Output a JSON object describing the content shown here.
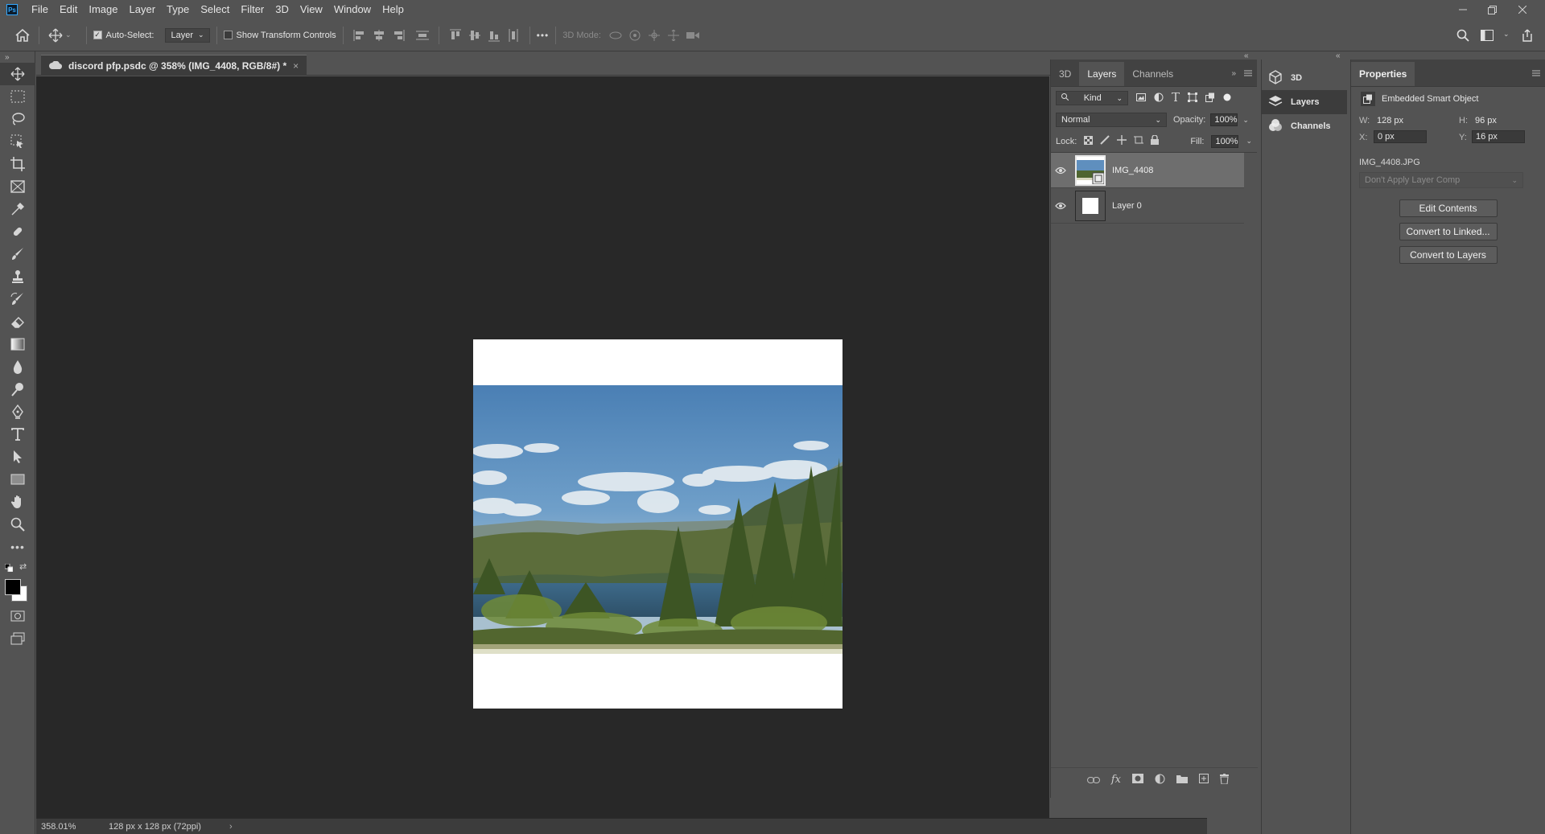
{
  "menubar": {
    "app_icon": "Ps",
    "items": [
      "File",
      "Edit",
      "Image",
      "Layer",
      "Type",
      "Select",
      "Filter",
      "3D",
      "View",
      "Window",
      "Help"
    ],
    "window_controls": [
      "minimize-icon",
      "restore-icon",
      "close-icon"
    ]
  },
  "options": {
    "auto_select_label": "Auto-Select:",
    "auto_select_checked": true,
    "auto_select_value": "Layer",
    "transform_label": "Show Transform Controls",
    "transform_checked": false,
    "more_label": "•••",
    "mode_label": "3D Mode:"
  },
  "document": {
    "tab_title": "discord pfp.psdc @ 358% (IMG_4408, RGB/8#) *",
    "close": "×"
  },
  "status": {
    "zoom": "358.01%",
    "doc_info": "128 px x 128 px (72ppi)",
    "arrow": "›"
  },
  "layers_panel": {
    "tabs": [
      "3D",
      "Layers",
      "Channels"
    ],
    "active_tab": "Layers",
    "filter_kind": "Kind",
    "blend_mode": "Normal",
    "opacity_label": "Opacity:",
    "opacity_value": "100%",
    "lock_label": "Lock:",
    "fill_label": "Fill:",
    "fill_value": "100%",
    "layers": [
      {
        "name": "IMG_4408",
        "visible": true,
        "selected": true,
        "type": "smart-object"
      },
      {
        "name": "Layer 0",
        "visible": true,
        "selected": false,
        "type": "normal"
      }
    ]
  },
  "mini_panel": {
    "items": [
      {
        "label": "3D",
        "icon": "cube-icon"
      },
      {
        "label": "Layers",
        "icon": "layers-icon"
      },
      {
        "label": "Channels",
        "icon": "channels-icon"
      }
    ],
    "active": "Layers"
  },
  "properties": {
    "title": "Properties",
    "object_type": "Embedded Smart Object",
    "w_label": "W:",
    "w_value": "128 px",
    "h_label": "H:",
    "h_value": "96 px",
    "x_label": "X:",
    "x_value": "0 px",
    "y_label": "Y:",
    "y_value": "16 px",
    "filename": "IMG_4408.JPG",
    "layer_comp": "Don't Apply Layer Comp",
    "buttons": [
      "Edit Contents",
      "Convert to Linked...",
      "Convert to Layers"
    ]
  }
}
